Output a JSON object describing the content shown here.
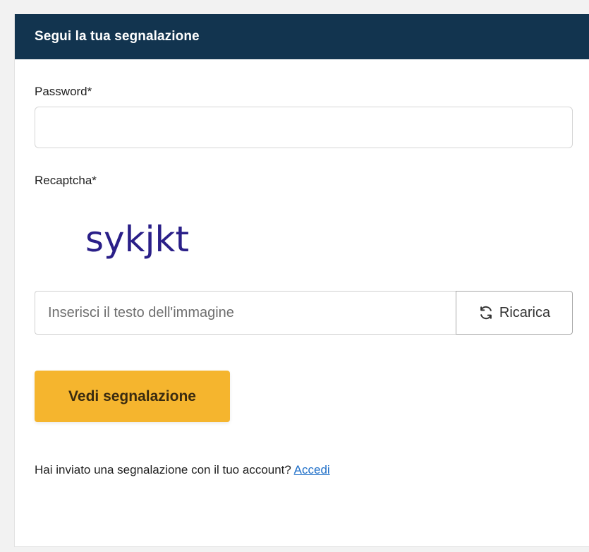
{
  "card": {
    "title": "Segui la tua segnalazione"
  },
  "form": {
    "password_label": "Password*",
    "password_value": "",
    "captcha_label": "Recaptcha*",
    "captcha_text": "sykjkt",
    "captcha_input_placeholder": "Inserisci il testo dell'immagine",
    "captcha_input_value": "",
    "reload_label": "Ricarica",
    "reload_icon": "refresh-icon",
    "submit_label": "Vedi segnalazione"
  },
  "footer": {
    "account_text": "Hai inviato una segnalazione con il tuo account?",
    "login_link": "Accedi"
  },
  "colors": {
    "header_bg": "#12344f",
    "primary_button": "#f5b52e",
    "link": "#1f6fc8"
  }
}
